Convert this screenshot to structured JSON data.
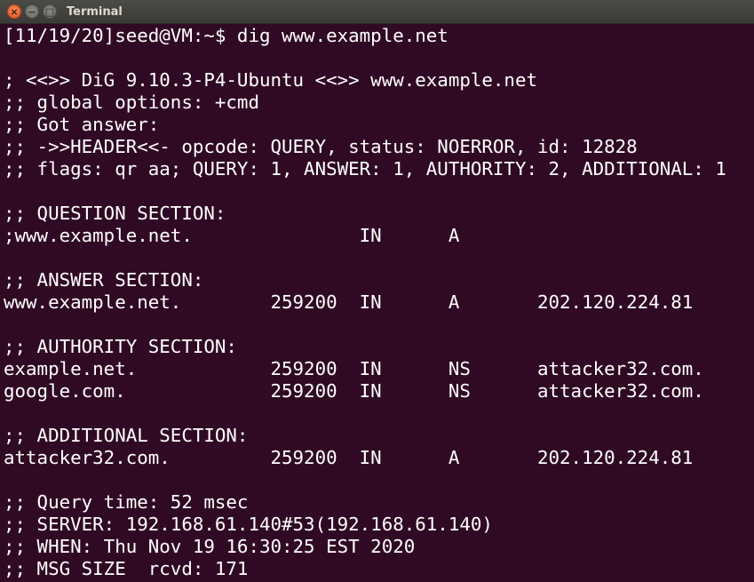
{
  "window": {
    "title": "Terminal",
    "close_glyph": "×",
    "minimize_glyph": "−",
    "maximize_glyph": "□"
  },
  "terminal": {
    "lines": [
      "[11/19/20]seed@VM:~$ dig www.example.net",
      "",
      "; <<>> DiG 9.10.3-P4-Ubuntu <<>> www.example.net",
      ";; global options: +cmd",
      ";; Got answer:",
      ";; ->>HEADER<<- opcode: QUERY, status: NOERROR, id: 12828",
      ";; flags: qr aa; QUERY: 1, ANSWER: 1, AUTHORITY: 2, ADDITIONAL: 1",
      "",
      ";; QUESTION SECTION:",
      ";www.example.net.               IN      A",
      "",
      ";; ANSWER SECTION:",
      "www.example.net.        259200  IN      A       202.120.224.81",
      "",
      ";; AUTHORITY SECTION:",
      "example.net.            259200  IN      NS      attacker32.com.",
      "google.com.             259200  IN      NS      attacker32.com.",
      "",
      ";; ADDITIONAL SECTION:",
      "attacker32.com.         259200  IN      A       202.120.224.81",
      "",
      ";; Query time: 52 msec",
      ";; SERVER: 192.168.61.140#53(192.168.61.140)",
      ";; WHEN: Thu Nov 19 16:30:25 EST 2020",
      ";; MSG SIZE  rcvd: 171"
    ]
  }
}
